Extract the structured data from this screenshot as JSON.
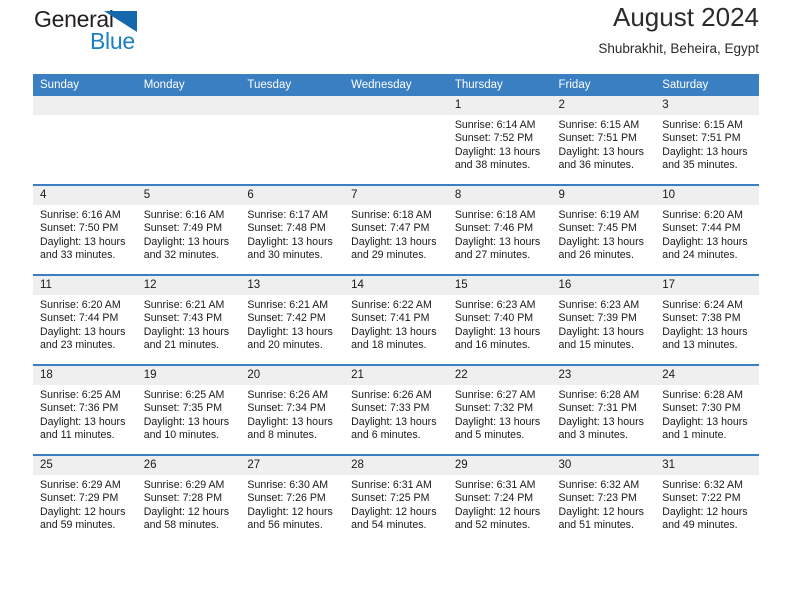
{
  "brand": {
    "name_top": "General",
    "name_bottom": "Blue",
    "accent_color": "#1c7fc4",
    "triangle_color": "#1668ad",
    "triangle_icon": "triangle-icon"
  },
  "header": {
    "title": "August 2024",
    "subtitle": "Shubrakhit, Beheira, Egypt"
  },
  "colors": {
    "header_row_bg": "#3a7fc1",
    "header_row_text": "#ffffff",
    "date_band_bg": "#efefef",
    "cell_bg": "#ffffff",
    "row_divider": "#3a7fc1"
  },
  "weekdays": [
    "Sunday",
    "Monday",
    "Tuesday",
    "Wednesday",
    "Thursday",
    "Friday",
    "Saturday"
  ],
  "weeks": [
    [
      {
        "day": "",
        "sunrise": "",
        "sunset": "",
        "daylight1": "",
        "daylight2": ""
      },
      {
        "day": "",
        "sunrise": "",
        "sunset": "",
        "daylight1": "",
        "daylight2": ""
      },
      {
        "day": "",
        "sunrise": "",
        "sunset": "",
        "daylight1": "",
        "daylight2": ""
      },
      {
        "day": "",
        "sunrise": "",
        "sunset": "",
        "daylight1": "",
        "daylight2": ""
      },
      {
        "day": "1",
        "sunrise": "Sunrise: 6:14 AM",
        "sunset": "Sunset: 7:52 PM",
        "daylight1": "Daylight: 13 hours",
        "daylight2": "and 38 minutes."
      },
      {
        "day": "2",
        "sunrise": "Sunrise: 6:15 AM",
        "sunset": "Sunset: 7:51 PM",
        "daylight1": "Daylight: 13 hours",
        "daylight2": "and 36 minutes."
      },
      {
        "day": "3",
        "sunrise": "Sunrise: 6:15 AM",
        "sunset": "Sunset: 7:51 PM",
        "daylight1": "Daylight: 13 hours",
        "daylight2": "and 35 minutes."
      }
    ],
    [
      {
        "day": "4",
        "sunrise": "Sunrise: 6:16 AM",
        "sunset": "Sunset: 7:50 PM",
        "daylight1": "Daylight: 13 hours",
        "daylight2": "and 33 minutes."
      },
      {
        "day": "5",
        "sunrise": "Sunrise: 6:16 AM",
        "sunset": "Sunset: 7:49 PM",
        "daylight1": "Daylight: 13 hours",
        "daylight2": "and 32 minutes."
      },
      {
        "day": "6",
        "sunrise": "Sunrise: 6:17 AM",
        "sunset": "Sunset: 7:48 PM",
        "daylight1": "Daylight: 13 hours",
        "daylight2": "and 30 minutes."
      },
      {
        "day": "7",
        "sunrise": "Sunrise: 6:18 AM",
        "sunset": "Sunset: 7:47 PM",
        "daylight1": "Daylight: 13 hours",
        "daylight2": "and 29 minutes."
      },
      {
        "day": "8",
        "sunrise": "Sunrise: 6:18 AM",
        "sunset": "Sunset: 7:46 PM",
        "daylight1": "Daylight: 13 hours",
        "daylight2": "and 27 minutes."
      },
      {
        "day": "9",
        "sunrise": "Sunrise: 6:19 AM",
        "sunset": "Sunset: 7:45 PM",
        "daylight1": "Daylight: 13 hours",
        "daylight2": "and 26 minutes."
      },
      {
        "day": "10",
        "sunrise": "Sunrise: 6:20 AM",
        "sunset": "Sunset: 7:44 PM",
        "daylight1": "Daylight: 13 hours",
        "daylight2": "and 24 minutes."
      }
    ],
    [
      {
        "day": "11",
        "sunrise": "Sunrise: 6:20 AM",
        "sunset": "Sunset: 7:44 PM",
        "daylight1": "Daylight: 13 hours",
        "daylight2": "and 23 minutes."
      },
      {
        "day": "12",
        "sunrise": "Sunrise: 6:21 AM",
        "sunset": "Sunset: 7:43 PM",
        "daylight1": "Daylight: 13 hours",
        "daylight2": "and 21 minutes."
      },
      {
        "day": "13",
        "sunrise": "Sunrise: 6:21 AM",
        "sunset": "Sunset: 7:42 PM",
        "daylight1": "Daylight: 13 hours",
        "daylight2": "and 20 minutes."
      },
      {
        "day": "14",
        "sunrise": "Sunrise: 6:22 AM",
        "sunset": "Sunset: 7:41 PM",
        "daylight1": "Daylight: 13 hours",
        "daylight2": "and 18 minutes."
      },
      {
        "day": "15",
        "sunrise": "Sunrise: 6:23 AM",
        "sunset": "Sunset: 7:40 PM",
        "daylight1": "Daylight: 13 hours",
        "daylight2": "and 16 minutes."
      },
      {
        "day": "16",
        "sunrise": "Sunrise: 6:23 AM",
        "sunset": "Sunset: 7:39 PM",
        "daylight1": "Daylight: 13 hours",
        "daylight2": "and 15 minutes."
      },
      {
        "day": "17",
        "sunrise": "Sunrise: 6:24 AM",
        "sunset": "Sunset: 7:38 PM",
        "daylight1": "Daylight: 13 hours",
        "daylight2": "and 13 minutes."
      }
    ],
    [
      {
        "day": "18",
        "sunrise": "Sunrise: 6:25 AM",
        "sunset": "Sunset: 7:36 PM",
        "daylight1": "Daylight: 13 hours",
        "daylight2": "and 11 minutes."
      },
      {
        "day": "19",
        "sunrise": "Sunrise: 6:25 AM",
        "sunset": "Sunset: 7:35 PM",
        "daylight1": "Daylight: 13 hours",
        "daylight2": "and 10 minutes."
      },
      {
        "day": "20",
        "sunrise": "Sunrise: 6:26 AM",
        "sunset": "Sunset: 7:34 PM",
        "daylight1": "Daylight: 13 hours",
        "daylight2": "and 8 minutes."
      },
      {
        "day": "21",
        "sunrise": "Sunrise: 6:26 AM",
        "sunset": "Sunset: 7:33 PM",
        "daylight1": "Daylight: 13 hours",
        "daylight2": "and 6 minutes."
      },
      {
        "day": "22",
        "sunrise": "Sunrise: 6:27 AM",
        "sunset": "Sunset: 7:32 PM",
        "daylight1": "Daylight: 13 hours",
        "daylight2": "and 5 minutes."
      },
      {
        "day": "23",
        "sunrise": "Sunrise: 6:28 AM",
        "sunset": "Sunset: 7:31 PM",
        "daylight1": "Daylight: 13 hours",
        "daylight2": "and 3 minutes."
      },
      {
        "day": "24",
        "sunrise": "Sunrise: 6:28 AM",
        "sunset": "Sunset: 7:30 PM",
        "daylight1": "Daylight: 13 hours",
        "daylight2": "and 1 minute."
      }
    ],
    [
      {
        "day": "25",
        "sunrise": "Sunrise: 6:29 AM",
        "sunset": "Sunset: 7:29 PM",
        "daylight1": "Daylight: 12 hours",
        "daylight2": "and 59 minutes."
      },
      {
        "day": "26",
        "sunrise": "Sunrise: 6:29 AM",
        "sunset": "Sunset: 7:28 PM",
        "daylight1": "Daylight: 12 hours",
        "daylight2": "and 58 minutes."
      },
      {
        "day": "27",
        "sunrise": "Sunrise: 6:30 AM",
        "sunset": "Sunset: 7:26 PM",
        "daylight1": "Daylight: 12 hours",
        "daylight2": "and 56 minutes."
      },
      {
        "day": "28",
        "sunrise": "Sunrise: 6:31 AM",
        "sunset": "Sunset: 7:25 PM",
        "daylight1": "Daylight: 12 hours",
        "daylight2": "and 54 minutes."
      },
      {
        "day": "29",
        "sunrise": "Sunrise: 6:31 AM",
        "sunset": "Sunset: 7:24 PM",
        "daylight1": "Daylight: 12 hours",
        "daylight2": "and 52 minutes."
      },
      {
        "day": "30",
        "sunrise": "Sunrise: 6:32 AM",
        "sunset": "Sunset: 7:23 PM",
        "daylight1": "Daylight: 12 hours",
        "daylight2": "and 51 minutes."
      },
      {
        "day": "31",
        "sunrise": "Sunrise: 6:32 AM",
        "sunset": "Sunset: 7:22 PM",
        "daylight1": "Daylight: 12 hours",
        "daylight2": "and 49 minutes."
      }
    ]
  ]
}
